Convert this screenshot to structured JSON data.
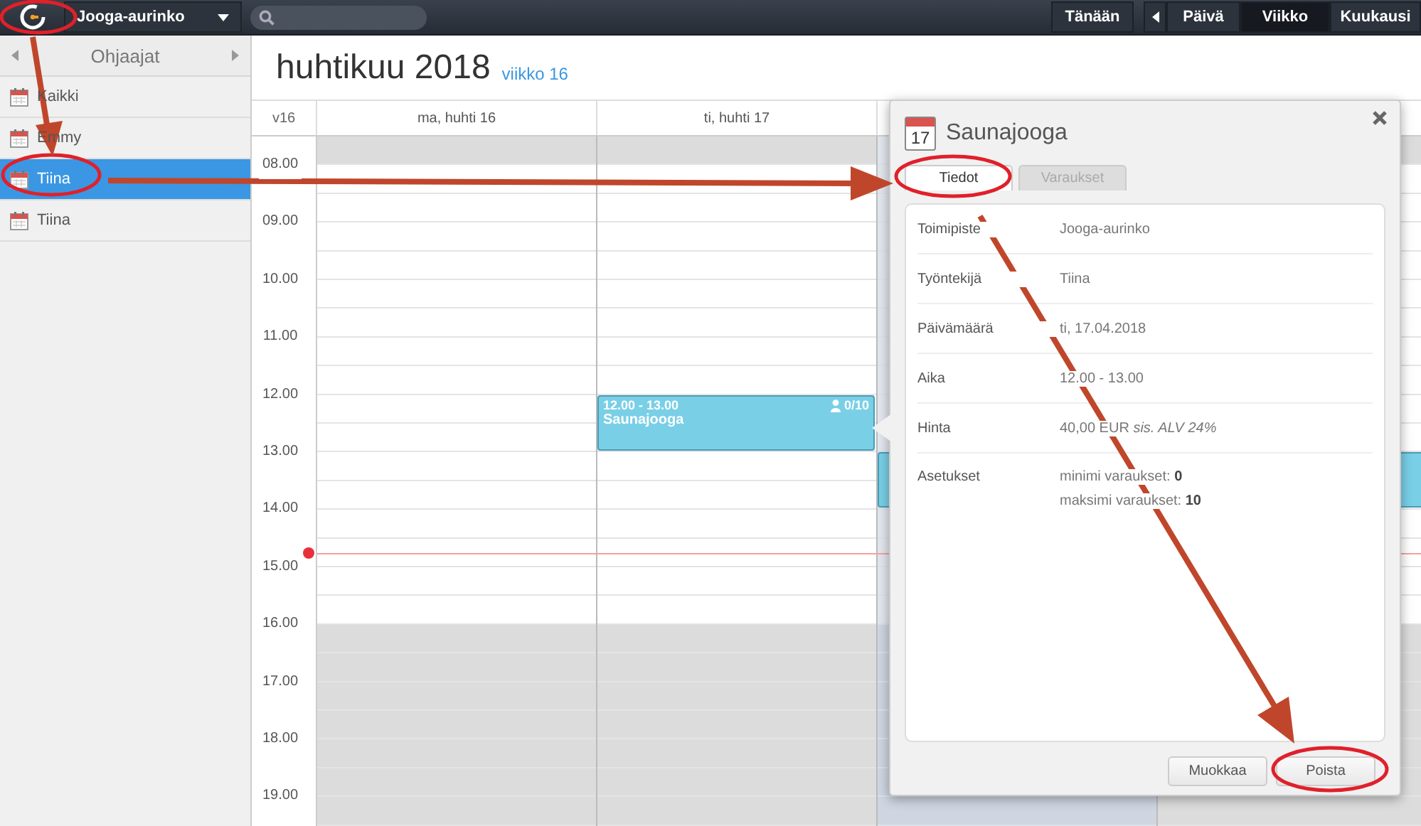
{
  "top_bar": {
    "location": "Jooga-aurinko",
    "buttons": [
      {
        "kind": "text",
        "label": "Tänään",
        "selected": false
      },
      {
        "kind": "prev",
        "selected": false
      },
      {
        "kind": "text",
        "label": "Päivä",
        "selected": false
      },
      {
        "kind": "text",
        "label": "Viikko",
        "selected": true
      },
      {
        "kind": "text",
        "label": "Kuukausi",
        "selected": false
      }
    ]
  },
  "sidebar": {
    "title": "Ohjaajat",
    "items": [
      {
        "label": "Kaikki",
        "selected": false
      },
      {
        "label": "Emmy",
        "selected": false
      },
      {
        "label": "Tiina",
        "selected": true
      },
      {
        "label": "Tiina",
        "selected": false
      }
    ]
  },
  "calendar": {
    "month": "huhtikuu 2018",
    "week_link": "viikko 16",
    "week_label": "v16",
    "hours": [
      "08.00",
      "09.00",
      "10.00",
      "11.00",
      "12.00",
      "13.00",
      "14.00",
      "15.00",
      "16.00",
      "17.00",
      "18.00",
      "19.00"
    ],
    "days": [
      {
        "label": "ma, huhti 16",
        "shaded": false
      },
      {
        "label": "ti, huhti 17",
        "shaded": false,
        "events": [
          {
            "kind": "full",
            "time": "12.00 - 13.00",
            "title": "Saunajooga",
            "count": "0/10"
          }
        ]
      },
      {
        "shaded": true,
        "events": [
          {
            "kind": "block"
          }
        ]
      },
      {
        "shaded": false,
        "events": [
          {
            "kind": "block"
          }
        ]
      }
    ]
  },
  "popup": {
    "icon_day": "17",
    "title": "Saunajooga",
    "tabs": [
      {
        "label": "Tiedot",
        "selected": true
      },
      {
        "label": "Varaukset",
        "selected": false
      }
    ],
    "rows": [
      {
        "label": "Toimipiste",
        "values": [
          "Jooga-aurinko"
        ]
      },
      {
        "label": "Työntekijä",
        "values": [
          "Tiina"
        ]
      },
      {
        "label": "Päivämäärä",
        "values": [
          "ti, 17.04.2018"
        ]
      },
      {
        "label": "Aika",
        "values": [
          "12.00 - 13.00"
        ]
      },
      {
        "label": "Hinta",
        "values": [
          "40,00 EUR *sis. ALV 24%*"
        ]
      },
      {
        "label": "Asetukset",
        "values": [
          "minimi varaukset: **0**",
          "maksimi varaukset: **10**"
        ]
      }
    ],
    "buttons": [
      "Muokkaa",
      "Poista"
    ]
  },
  "annotations": [
    {
      "kind": "ellipse"
    },
    {
      "kind": "ellipse"
    },
    {
      "kind": "ellipse"
    },
    {
      "kind": "ellipse"
    },
    {
      "kind": "arrow"
    },
    {
      "kind": "arrow"
    },
    {
      "kind": "arrow"
    }
  ]
}
